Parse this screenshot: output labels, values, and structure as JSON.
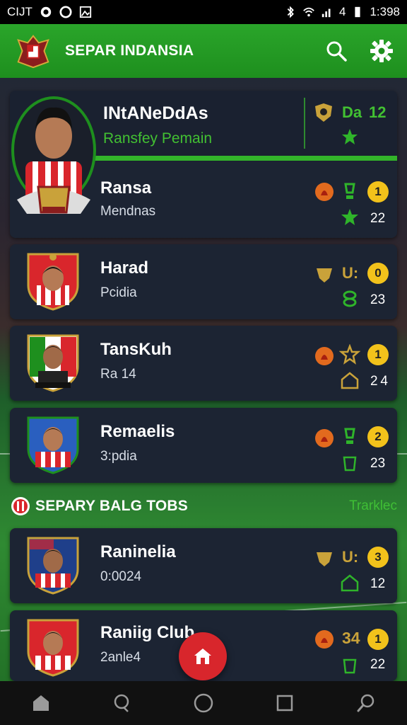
{
  "status_bar": {
    "carrier": "CIJT",
    "time": "1:398",
    "signal_label": "4"
  },
  "app": {
    "title": "SEPAR INDANSIA",
    "logo_icon": "garuda-crest-icon",
    "search_icon": "search-icon",
    "settings_icon": "gear-icon"
  },
  "featured": {
    "name": "INtANeDdAs",
    "subtitle": "Ransfey Pemain",
    "badge_label": "Da",
    "badge_value": "12"
  },
  "players": [
    {
      "name": "Ransa",
      "sub": "Mendnas",
      "coin": "1",
      "count": "22"
    },
    {
      "name": "Harad",
      "sub": "Pcidia",
      "coin": "0",
      "count": "23",
      "mid": "U:"
    },
    {
      "name": "TansKuh",
      "sub": "Ra 14",
      "coin": "1",
      "count": "2 4"
    },
    {
      "name": "Remaelis",
      "sub": "3:pdia",
      "coin": "2",
      "count": "23"
    }
  ],
  "section": {
    "title": "SEPARY BALG TOBS",
    "link": "Trarklec"
  },
  "players2": [
    {
      "name": "Raninelia",
      "sub": "0:0024",
      "coin": "3",
      "count": "12",
      "mid": "U:"
    },
    {
      "name": "Raniig Club",
      "sub": "2anle4",
      "coin": "1",
      "count": "22",
      "mid": "34"
    }
  ],
  "colors": {
    "brand_green": "#2aa52a",
    "accent_red": "#d8262c",
    "coin_gold": "#f2c21b",
    "card_bg": "#1c2433"
  },
  "nav": [
    "home-icon",
    "chat-icon",
    "circle-icon",
    "square-icon",
    "search-icon"
  ]
}
